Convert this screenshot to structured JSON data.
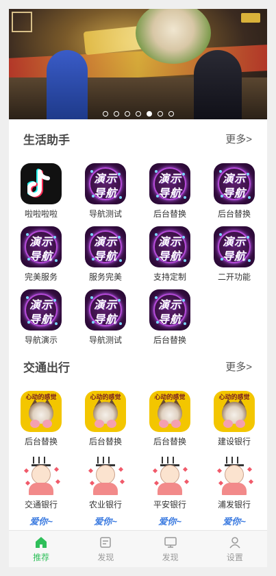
{
  "banner": {
    "dots": 7,
    "active_dot": 4
  },
  "sections": [
    {
      "title": "生活助手",
      "more": "更多>",
      "items": [
        {
          "label": "啦啦啦啦",
          "icon": "tiktok-icon"
        },
        {
          "label": "导航测试",
          "icon": "demo-nav-icon"
        },
        {
          "label": "后台替换",
          "icon": "demo-nav-icon"
        },
        {
          "label": "后台替换",
          "icon": "demo-nav-icon"
        },
        {
          "label": "完美服务",
          "icon": "demo-nav-icon"
        },
        {
          "label": "服务完美",
          "icon": "demo-nav-icon"
        },
        {
          "label": "支持定制",
          "icon": "demo-nav-icon"
        },
        {
          "label": "二开功能",
          "icon": "demo-nav-icon"
        },
        {
          "label": "导航演示",
          "icon": "demo-nav-icon"
        },
        {
          "label": "导航测试",
          "icon": "demo-nav-icon"
        },
        {
          "label": "后台替换",
          "icon": "demo-nav-icon"
        }
      ]
    },
    {
      "title": "交通出行",
      "more": "更多>",
      "items": [
        {
          "label": "后台替换",
          "icon": "cat-icon"
        },
        {
          "label": "后台替换",
          "icon": "cat-icon"
        },
        {
          "label": "后台替换",
          "icon": "cat-icon"
        },
        {
          "label": "建设银行",
          "icon": "cat-icon"
        },
        {
          "label": "交通银行",
          "icon": "cartoon-boy-icon"
        },
        {
          "label": "农业银行",
          "icon": "cartoon-boy-icon"
        },
        {
          "label": "平安银行",
          "icon": "cartoon-boy-icon"
        },
        {
          "label": "浦发银行",
          "icon": "cartoon-boy-icon"
        }
      ]
    }
  ],
  "demo_icon_text": {
    "line1": "演示",
    "line2": "导航"
  },
  "cat_icon_text": "心动的感觉",
  "partial_row_text": "爱你~",
  "tabbar": [
    {
      "label": "推荐",
      "icon": "home-icon",
      "active": true
    },
    {
      "label": "发现",
      "icon": "document-icon",
      "active": false
    },
    {
      "label": "发现",
      "icon": "monitor-icon",
      "active": false
    },
    {
      "label": "设置",
      "icon": "user-icon",
      "active": false
    }
  ],
  "colors": {
    "accent": "#2fbf5a",
    "inactive": "#999999"
  }
}
